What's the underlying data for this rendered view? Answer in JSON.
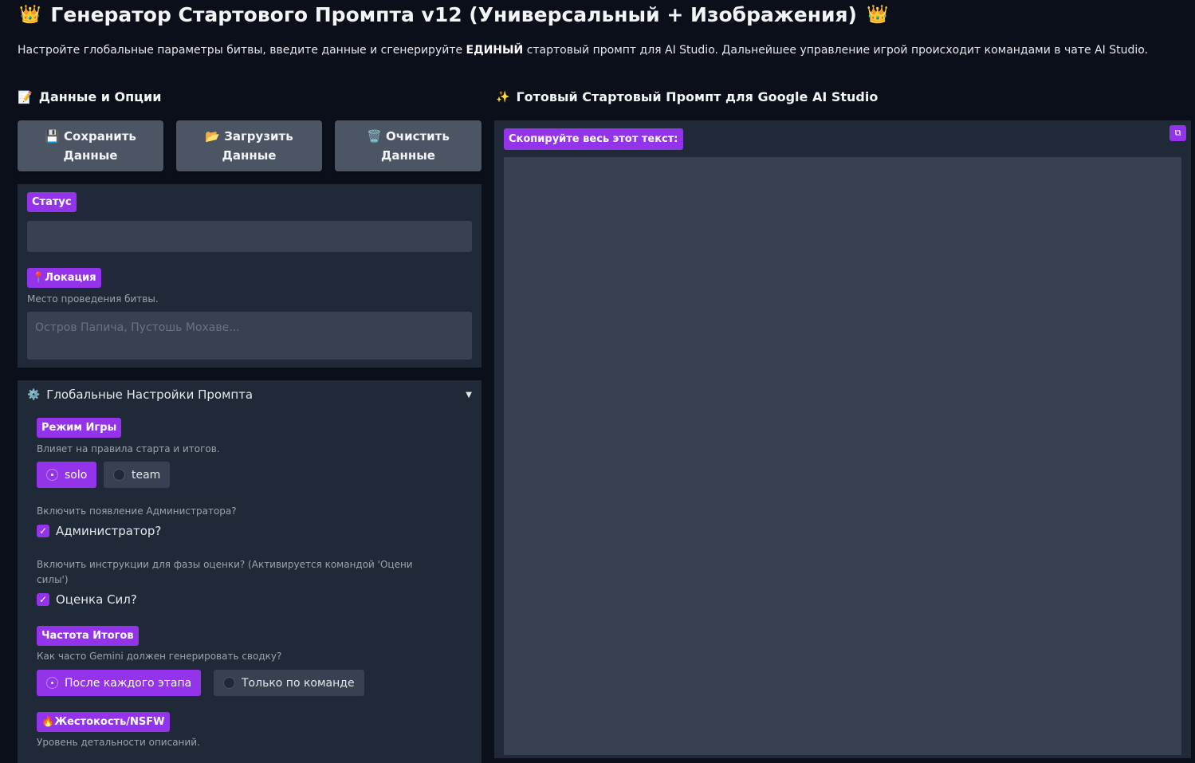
{
  "header": {
    "title": "Генератор Стартового Промпта v12 (Универсальный + Изображения)",
    "crown_icon": "crown-icon",
    "subtitle_pre": "Настройте глобальные параметры битвы, введите данные и сгенерируйте ",
    "subtitle_bold": "ЕДИНЫЙ",
    "subtitle_post": " стартовый промпт для AI Studio. Дальнейшее управление игрой происходит командами в чате AI Studio."
  },
  "left": {
    "section_title": "Данные и Опции",
    "section_icon": "memo-icon",
    "buttons": [
      {
        "icon": "floppy-icon",
        "line1": "Сохранить",
        "line2": "Данные"
      },
      {
        "icon": "folder-icon",
        "line1": "Загрузить",
        "line2": "Данные"
      },
      {
        "icon": "trash-icon",
        "line1": "Очистить",
        "line2": "Данные"
      }
    ],
    "status": {
      "label": "Статус",
      "value": ""
    },
    "location": {
      "label": "Локация",
      "icon": "pin-icon",
      "hint": "Место проведения битвы.",
      "placeholder": "Остров Папича, Пустошь Мохаве..."
    },
    "global_settings": {
      "title": "Глобальные Настройки Промпта",
      "icon": "gear-icon",
      "game_mode": {
        "label": "Режим Игры",
        "hint": "Влияет на правила старта и итогов.",
        "options": [
          "solo",
          "team"
        ],
        "selected": "solo"
      },
      "admin": {
        "hint": "Включить появление Администратора?",
        "label": "Администратор?",
        "checked": true
      },
      "power_eval": {
        "hint": "Включить инструкции для фазы оценки? (Активируется командой 'Оцени силы')",
        "label": "Оценка Сил?",
        "checked": true
      },
      "summary_freq": {
        "label": "Частота Итогов",
        "hint": "Как часто Gemini должен генерировать сводку?",
        "options": [
          "После каждого этапа",
          "Только по команде"
        ],
        "selected": "После каждого этапа"
      },
      "violence": {
        "label": "Жестокость/NSFW",
        "icon": "fire-icon",
        "hint": "Уровень детальности описаний."
      }
    }
  },
  "right": {
    "section_title": "Готовый Стартовый Промпт для Google AI Studio",
    "section_icon": "sparkles-icon",
    "copy_label": "Скопируйте весь этот текст:",
    "prompt_value": ""
  },
  "colors": {
    "accent": "#9333ea",
    "background": "#0b0f19",
    "panel": "#1f2937",
    "field": "#374151",
    "button": "#4b5563"
  }
}
